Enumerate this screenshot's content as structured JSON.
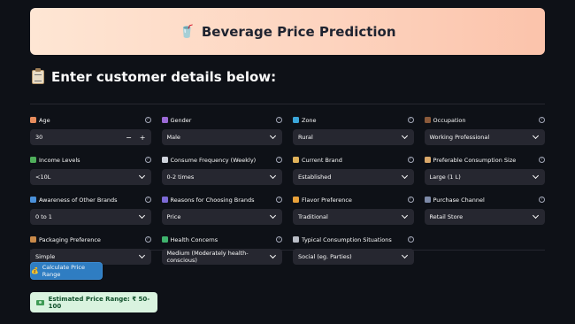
{
  "banner": {
    "title": "Beverage Price Prediction",
    "icon": "drink-cup-icon"
  },
  "section": {
    "title": "Enter customer details below:",
    "icon": "clipboard-icon"
  },
  "fields": [
    {
      "label": "Age",
      "value": "30",
      "type": "number",
      "icon": "cake-icon",
      "icon_color": "#e58b5c"
    },
    {
      "label": "Gender",
      "value": "Male",
      "type": "select",
      "icon": "gender-icon",
      "icon_color": "#9b6ad6"
    },
    {
      "label": "Zone",
      "value": "Rural",
      "type": "select",
      "icon": "globe-icon",
      "icon_color": "#3ba6d9"
    },
    {
      "label": "Occupation",
      "value": "Working Professional",
      "type": "select",
      "icon": "briefcase-icon",
      "icon_color": "#8a5a3b"
    },
    {
      "label": "Income Levels",
      "value": "<10L",
      "type": "select",
      "icon": "money-icon",
      "icon_color": "#4fae5b"
    },
    {
      "label": "Consume Frequency (Weekly)",
      "value": "0-2 times",
      "type": "select",
      "icon": "calendar-icon",
      "icon_color": "#cfd3dc"
    },
    {
      "label": "Current Brand",
      "value": "Established",
      "type": "select",
      "icon": "tag-icon",
      "icon_color": "#e0b25a"
    },
    {
      "label": "Preferable Consumption Size",
      "value": "Large (1 L)",
      "type": "select",
      "icon": "ruler-icon",
      "icon_color": "#d9a86a"
    },
    {
      "label": "Awareness of Other Brands",
      "value": "0 to 1",
      "type": "select",
      "icon": "magnifier-icon",
      "icon_color": "#4a90d9"
    },
    {
      "label": "Reasons for Choosing Brands",
      "value": "Price",
      "type": "select",
      "icon": "thinking-icon",
      "icon_color": "#7c6ad6"
    },
    {
      "label": "Flavor Preference",
      "value": "Traditional",
      "type": "select",
      "icon": "flavor-icon",
      "icon_color": "#e8a13a"
    },
    {
      "label": "Purchase Channel",
      "value": "Retail Store",
      "type": "select",
      "icon": "store-icon",
      "icon_color": "#7d8aa8"
    },
    {
      "label": "Packaging Preference",
      "value": "Simple",
      "type": "select",
      "icon": "package-icon",
      "icon_color": "#c98a4a"
    },
    {
      "label": "Health Concerns",
      "value": "Medium (Moderately health-conscious)",
      "type": "select",
      "icon": "heart-icon",
      "icon_color": "#3fb36d"
    },
    {
      "label": "Typical Consumption Situations",
      "value": "Social (eg. Parties)",
      "type": "select",
      "icon": "people-icon",
      "icon_color": "#b9bdc6"
    }
  ],
  "stepper": {
    "minus": "−",
    "plus": "+"
  },
  "help_glyph": "?",
  "button": {
    "label": "Calculate Price Range",
    "icon": "money-bag-icon"
  },
  "result": {
    "text": "Estimated Price Range: ₹ 50-100",
    "icon": "banknote-icon"
  },
  "colors": {
    "background": "#0e1117",
    "input": "#262730",
    "button": "#2f7dc2",
    "result_bg": "#d9f3df",
    "result_text": "#0f4f2a"
  }
}
